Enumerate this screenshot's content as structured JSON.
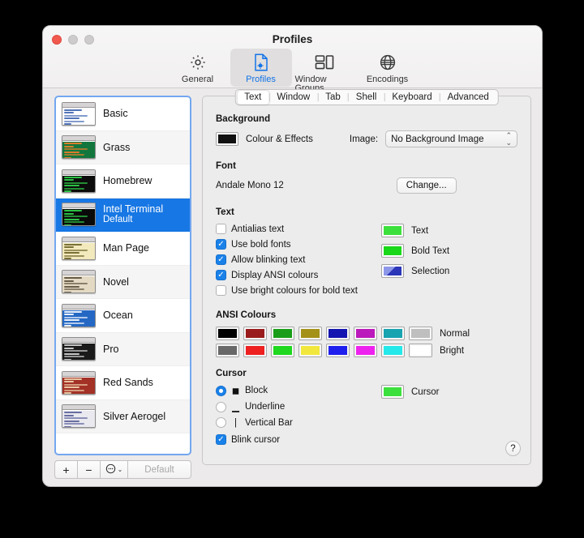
{
  "window": {
    "title": "Profiles"
  },
  "toolbar": {
    "items": [
      {
        "label": "General",
        "icon": "gear-icon",
        "active": false
      },
      {
        "label": "Profiles",
        "icon": "document-gear-icon",
        "active": true
      },
      {
        "label": "Window Groups",
        "icon": "window-groups-icon",
        "active": false
      },
      {
        "label": "Encodings",
        "icon": "globe-icon",
        "active": false
      }
    ]
  },
  "profiles": {
    "items": [
      {
        "name": "Basic",
        "subtitle": "",
        "selected": false,
        "bg": "#ffffff",
        "fg": "#3f66b0"
      },
      {
        "name": "Grass",
        "subtitle": "",
        "selected": false,
        "bg": "#13773d",
        "fg": "#f07d2a"
      },
      {
        "name": "Homebrew",
        "subtitle": "",
        "selected": false,
        "bg": "#0c0c0c",
        "fg": "#2fd44a"
      },
      {
        "name": "Intel Terminal",
        "subtitle": "Default",
        "selected": true,
        "bg": "#0a0a0a",
        "fg": "#2fd44a"
      },
      {
        "name": "Man Page",
        "subtitle": "",
        "selected": false,
        "bg": "#f2e9bd",
        "fg": "#6c6327"
      },
      {
        "name": "Novel",
        "subtitle": "",
        "selected": false,
        "bg": "#e4dac4",
        "fg": "#5a4f3c"
      },
      {
        "name": "Ocean",
        "subtitle": "",
        "selected": false,
        "bg": "#2468c4",
        "fg": "#ffffff"
      },
      {
        "name": "Pro",
        "subtitle": "",
        "selected": false,
        "bg": "#1a1a1a",
        "fg": "#d8d8d8"
      },
      {
        "name": "Red Sands",
        "subtitle": "",
        "selected": false,
        "bg": "#a33126",
        "fg": "#f0d6b0"
      },
      {
        "name": "Silver Aerogel",
        "subtitle": "",
        "selected": false,
        "bg": "#e9e9ef",
        "fg": "#5b5f98"
      }
    ],
    "tools": {
      "add": "+",
      "remove": "−",
      "actions": "⊙",
      "actions_chevron": "⌄",
      "default_label": "Default"
    }
  },
  "tabs": [
    {
      "label": "Text",
      "active": true
    },
    {
      "label": "Window",
      "active": false
    },
    {
      "label": "Tab",
      "active": false
    },
    {
      "label": "Shell",
      "active": false
    },
    {
      "label": "Keyboard",
      "active": false
    },
    {
      "label": "Advanced",
      "active": false
    }
  ],
  "background": {
    "title": "Background",
    "colour_effects_label": "Colour & Effects",
    "colour_swatch": "#111111",
    "image_label": "Image:",
    "image_value": "No Background Image"
  },
  "font": {
    "title": "Font",
    "value": "Andale Mono 12",
    "change_label": "Change..."
  },
  "text": {
    "title": "Text",
    "checkboxes": [
      {
        "label": "Antialias text",
        "checked": false
      },
      {
        "label": "Use bold fonts",
        "checked": true
      },
      {
        "label": "Allow blinking text",
        "checked": true
      },
      {
        "label": "Display ANSI colours",
        "checked": true
      },
      {
        "label": "Use bright colours for bold text",
        "checked": false
      }
    ],
    "colours": [
      {
        "label": "Text",
        "colour": "#3ce03c"
      },
      {
        "label": "Bold Text",
        "colour": "#19d819"
      },
      {
        "label": "Selection",
        "colour": "#2b36b8"
      }
    ]
  },
  "ansi": {
    "title": "ANSI Colours",
    "normal_label": "Normal",
    "bright_label": "Bright",
    "normal": [
      "#000000",
      "#991b1b",
      "#1a9e1a",
      "#a39118",
      "#1414b0",
      "#bb19bb",
      "#17a3b0",
      "#bfbfbf"
    ],
    "bright": [
      "#686868",
      "#ee2020",
      "#1fd81f",
      "#f2e73d",
      "#1f1fee",
      "#ee22ee",
      "#25e8ea",
      "#ffffff"
    ]
  },
  "cursor": {
    "title": "Cursor",
    "options": [
      {
        "label": "Block",
        "glyph": "◼",
        "selected": true
      },
      {
        "label": "Underline",
        "glyph": "▁",
        "selected": false
      },
      {
        "label": "Vertical Bar",
        "glyph": "|",
        "selected": false
      }
    ],
    "blink": {
      "label": "Blink cursor",
      "checked": true
    },
    "colour_label": "Cursor",
    "colour": "#3ce03c"
  },
  "help": {
    "label": "?"
  }
}
